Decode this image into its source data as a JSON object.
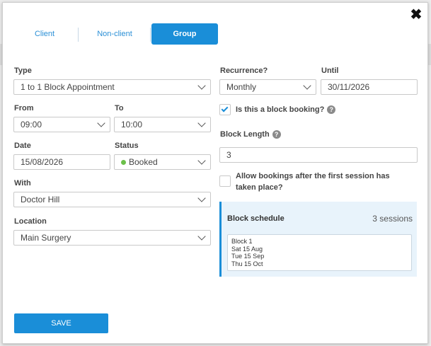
{
  "tabs": {
    "client": "Client",
    "non_client": "Non-client",
    "group": "Group"
  },
  "type": {
    "label": "Type",
    "value": "1 to 1 Block Appointment"
  },
  "from": {
    "label": "From",
    "value": "09:00"
  },
  "to": {
    "label": "To",
    "value": "10:00"
  },
  "date": {
    "label": "Date",
    "value": "15/08/2026"
  },
  "status": {
    "label": "Status",
    "value": "Booked",
    "dot_color": "#6cc04a"
  },
  "with": {
    "label": "With",
    "value": "Doctor Hill"
  },
  "location": {
    "label": "Location",
    "value": "Main Surgery"
  },
  "recurrence": {
    "label": "Recurrence?",
    "value": "Monthly"
  },
  "until": {
    "label": "Until",
    "value": "30/11/2026"
  },
  "block_booking": {
    "label": "Is this a block booking?",
    "checked": true
  },
  "block_length": {
    "label": "Block Length",
    "value": "3"
  },
  "allow_after": {
    "label": "Allow bookings after the first session has taken place?",
    "checked": false
  },
  "block_schedule": {
    "title": "Block schedule",
    "count": "3 sessions",
    "block_name": "Block 1",
    "sessions": [
      "Sat 15 Aug",
      "Tue 15 Sep",
      "Thu 15 Oct"
    ]
  },
  "help_glyph": "?",
  "close_glyph": "✖",
  "save_label": "SAVE",
  "colors": {
    "accent": "#1a8ed8",
    "panel_bg": "#e8f3fb"
  }
}
